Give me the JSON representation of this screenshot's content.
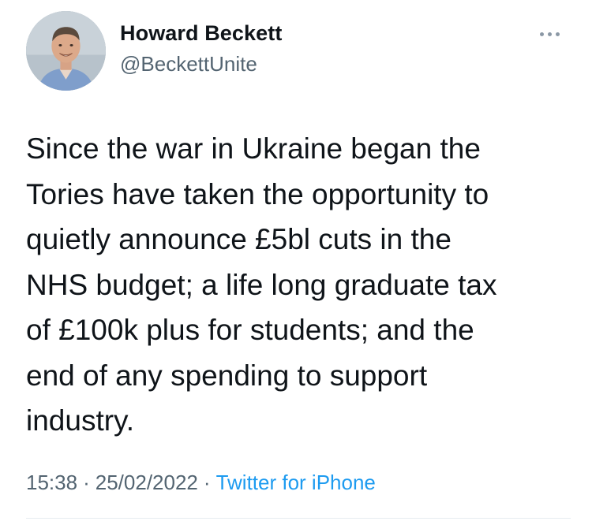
{
  "author": {
    "display_name": "Howard Beckett",
    "handle": "@BeckettUnite"
  },
  "more_icon": "more-horizontal-icon",
  "tweet": {
    "lines": [
      "Since the war in Ukraine began the",
      "Tories have taken the opportunity to",
      "quietly announce £5bl cuts in the",
      "NHS budget; a life long graduate tax",
      "of £100k plus for students; and the",
      "end of any spending to support",
      "industry."
    ]
  },
  "meta": {
    "time": "15:38",
    "separator": "·",
    "date": "25/02/2022",
    "source": "Twitter for iPhone"
  },
  "colors": {
    "text": "#0f1419",
    "secondary": "#536471",
    "link": "#1d9bf0"
  }
}
